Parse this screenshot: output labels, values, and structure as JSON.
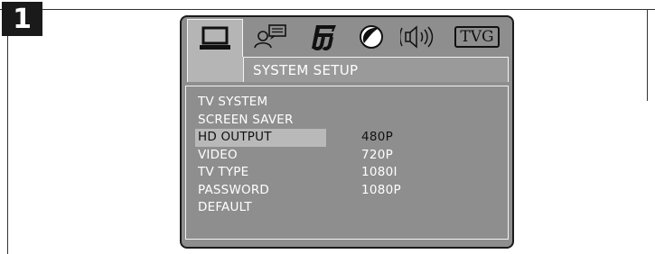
{
  "step": {
    "number": "1"
  },
  "screen": {
    "icons": [
      {
        "name": "system-setup-icon",
        "selected": true
      },
      {
        "name": "language-icon",
        "selected": false
      },
      {
        "name": "audio-music-icon",
        "selected": false
      },
      {
        "name": "video-picture-icon",
        "selected": false
      },
      {
        "name": "speaker-icon",
        "selected": false
      },
      {
        "name": "tvg-icon",
        "label": "TVG",
        "selected": false
      }
    ],
    "title": "SYSTEM SETUP",
    "menu": {
      "items": [
        {
          "label": "TV SYSTEM"
        },
        {
          "label": "SCREEN SAVER"
        },
        {
          "label": "HD OUTPUT",
          "active": true
        },
        {
          "label": "VIDEO"
        },
        {
          "label": "TV TYPE"
        },
        {
          "label": "PASSWORD"
        },
        {
          "label": "DEFAULT"
        }
      ]
    },
    "options": {
      "items": [
        {
          "label": "480P",
          "selected": true
        },
        {
          "label": "720P"
        },
        {
          "label": "1080I"
        },
        {
          "label": "1080P"
        }
      ]
    }
  },
  "colors": {
    "screen_background": "#8e8e8e",
    "highlight": "#b9b9b9",
    "menu_text": "#ffffff",
    "selected_text": "#111111",
    "badge_background": "#1a1a1a"
  }
}
